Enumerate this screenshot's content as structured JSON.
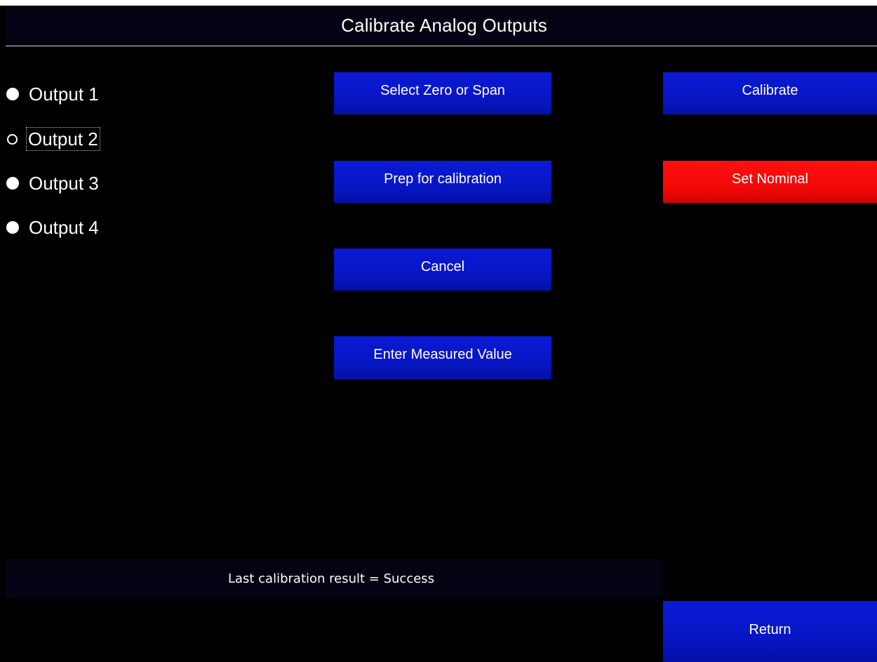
{
  "header": {
    "title": "Calibrate Analog Outputs"
  },
  "outputs": [
    {
      "label": "Output 1",
      "selected": false
    },
    {
      "label": "Output 2",
      "selected": true
    },
    {
      "label": "Output 3",
      "selected": false
    },
    {
      "label": "Output 4",
      "selected": false
    }
  ],
  "actions": {
    "select_zero_span": "Select Zero or Span",
    "prep_calibration": "Prep for calibration",
    "cancel": "Cancel",
    "enter_measured": "Enter Measured Value",
    "calibrate": "Calibrate",
    "set_nominal": "Set Nominal",
    "return": "Return"
  },
  "status": {
    "text": "Last calibration result = Success"
  },
  "colors": {
    "background": "#000000",
    "header_bg": "#030313",
    "button_blue": "#0716c4",
    "button_red": "#f40808",
    "text": "#ffffff"
  }
}
